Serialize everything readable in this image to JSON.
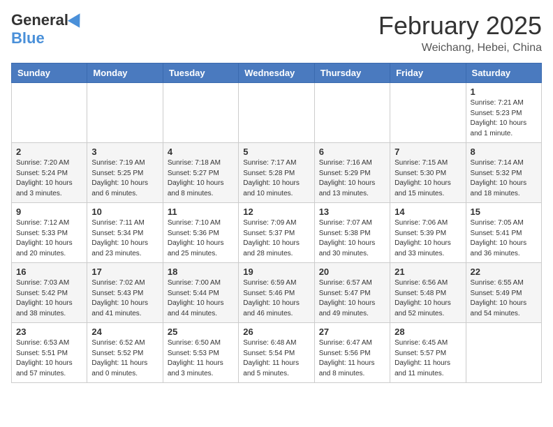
{
  "header": {
    "logo_general": "General",
    "logo_blue": "Blue",
    "month_title": "February 2025",
    "location": "Weichang, Hebei, China"
  },
  "days_of_week": [
    "Sunday",
    "Monday",
    "Tuesday",
    "Wednesday",
    "Thursday",
    "Friday",
    "Saturday"
  ],
  "weeks": [
    [
      {
        "day": "",
        "info": ""
      },
      {
        "day": "",
        "info": ""
      },
      {
        "day": "",
        "info": ""
      },
      {
        "day": "",
        "info": ""
      },
      {
        "day": "",
        "info": ""
      },
      {
        "day": "",
        "info": ""
      },
      {
        "day": "1",
        "info": "Sunrise: 7:21 AM\nSunset: 5:23 PM\nDaylight: 10 hours and 1 minute."
      }
    ],
    [
      {
        "day": "2",
        "info": "Sunrise: 7:20 AM\nSunset: 5:24 PM\nDaylight: 10 hours and 3 minutes."
      },
      {
        "day": "3",
        "info": "Sunrise: 7:19 AM\nSunset: 5:25 PM\nDaylight: 10 hours and 6 minutes."
      },
      {
        "day": "4",
        "info": "Sunrise: 7:18 AM\nSunset: 5:27 PM\nDaylight: 10 hours and 8 minutes."
      },
      {
        "day": "5",
        "info": "Sunrise: 7:17 AM\nSunset: 5:28 PM\nDaylight: 10 hours and 10 minutes."
      },
      {
        "day": "6",
        "info": "Sunrise: 7:16 AM\nSunset: 5:29 PM\nDaylight: 10 hours and 13 minutes."
      },
      {
        "day": "7",
        "info": "Sunrise: 7:15 AM\nSunset: 5:30 PM\nDaylight: 10 hours and 15 minutes."
      },
      {
        "day": "8",
        "info": "Sunrise: 7:14 AM\nSunset: 5:32 PM\nDaylight: 10 hours and 18 minutes."
      }
    ],
    [
      {
        "day": "9",
        "info": "Sunrise: 7:12 AM\nSunset: 5:33 PM\nDaylight: 10 hours and 20 minutes."
      },
      {
        "day": "10",
        "info": "Sunrise: 7:11 AM\nSunset: 5:34 PM\nDaylight: 10 hours and 23 minutes."
      },
      {
        "day": "11",
        "info": "Sunrise: 7:10 AM\nSunset: 5:36 PM\nDaylight: 10 hours and 25 minutes."
      },
      {
        "day": "12",
        "info": "Sunrise: 7:09 AM\nSunset: 5:37 PM\nDaylight: 10 hours and 28 minutes."
      },
      {
        "day": "13",
        "info": "Sunrise: 7:07 AM\nSunset: 5:38 PM\nDaylight: 10 hours and 30 minutes."
      },
      {
        "day": "14",
        "info": "Sunrise: 7:06 AM\nSunset: 5:39 PM\nDaylight: 10 hours and 33 minutes."
      },
      {
        "day": "15",
        "info": "Sunrise: 7:05 AM\nSunset: 5:41 PM\nDaylight: 10 hours and 36 minutes."
      }
    ],
    [
      {
        "day": "16",
        "info": "Sunrise: 7:03 AM\nSunset: 5:42 PM\nDaylight: 10 hours and 38 minutes."
      },
      {
        "day": "17",
        "info": "Sunrise: 7:02 AM\nSunset: 5:43 PM\nDaylight: 10 hours and 41 minutes."
      },
      {
        "day": "18",
        "info": "Sunrise: 7:00 AM\nSunset: 5:44 PM\nDaylight: 10 hours and 44 minutes."
      },
      {
        "day": "19",
        "info": "Sunrise: 6:59 AM\nSunset: 5:46 PM\nDaylight: 10 hours and 46 minutes."
      },
      {
        "day": "20",
        "info": "Sunrise: 6:57 AM\nSunset: 5:47 PM\nDaylight: 10 hours and 49 minutes."
      },
      {
        "day": "21",
        "info": "Sunrise: 6:56 AM\nSunset: 5:48 PM\nDaylight: 10 hours and 52 minutes."
      },
      {
        "day": "22",
        "info": "Sunrise: 6:55 AM\nSunset: 5:49 PM\nDaylight: 10 hours and 54 minutes."
      }
    ],
    [
      {
        "day": "23",
        "info": "Sunrise: 6:53 AM\nSunset: 5:51 PM\nDaylight: 10 hours and 57 minutes."
      },
      {
        "day": "24",
        "info": "Sunrise: 6:52 AM\nSunset: 5:52 PM\nDaylight: 11 hours and 0 minutes."
      },
      {
        "day": "25",
        "info": "Sunrise: 6:50 AM\nSunset: 5:53 PM\nDaylight: 11 hours and 3 minutes."
      },
      {
        "day": "26",
        "info": "Sunrise: 6:48 AM\nSunset: 5:54 PM\nDaylight: 11 hours and 5 minutes."
      },
      {
        "day": "27",
        "info": "Sunrise: 6:47 AM\nSunset: 5:56 PM\nDaylight: 11 hours and 8 minutes."
      },
      {
        "day": "28",
        "info": "Sunrise: 6:45 AM\nSunset: 5:57 PM\nDaylight: 11 hours and 11 minutes."
      },
      {
        "day": "",
        "info": ""
      }
    ]
  ]
}
